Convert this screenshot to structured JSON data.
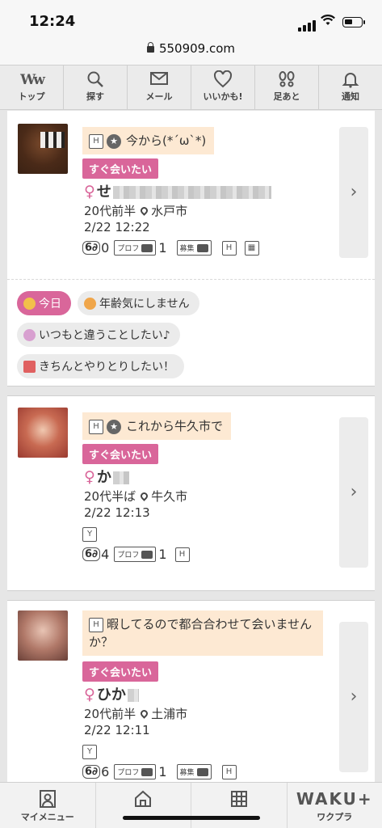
{
  "status": {
    "time": "12:24"
  },
  "browser": {
    "url": "550909.com"
  },
  "topnav": [
    {
      "label": "トップ",
      "icon": "ww-logo-icon",
      "glyph": "Ww"
    },
    {
      "label": "探す",
      "icon": "search-icon",
      "glyph": "⌕"
    },
    {
      "label": "メール",
      "icon": "mail-icon",
      "glyph": "✉"
    },
    {
      "label": "いいかも!",
      "icon": "heart-icon",
      "glyph": "♡"
    },
    {
      "label": "足あと",
      "icon": "footprints-icon",
      "glyph": "❀"
    },
    {
      "label": "通知",
      "icon": "bell-icon",
      "glyph": "🔔"
    }
  ],
  "cards": [
    {
      "message": "今から(*´ω`*)",
      "badge": "すぐ会いたい",
      "name": "せ",
      "age": "20代前半",
      "location": "水戸市",
      "datetime": "2/22 12:22",
      "views": "0",
      "prof_label": "プロフ",
      "prof_photos": "1",
      "boshu_label": "募集"
    },
    {
      "message": "これから牛久市で",
      "badge": "すぐ会いたい",
      "name": "か",
      "age": "20代半ば",
      "location": "牛久市",
      "datetime": "2/22 12:13",
      "views": "4",
      "prof_label": "プロフ",
      "prof_photos": "1"
    },
    {
      "message": "暇してるので都合合わせて会いませんか？",
      "badge": "すぐ会いたい",
      "name": "ひか",
      "age": "20代前半",
      "location": "土浦市",
      "datetime": "2/22 12:11",
      "views": "6",
      "prof_label": "プロフ",
      "prof_photos": "1",
      "boshu_label": "募集"
    }
  ],
  "tags": {
    "today": "今日",
    "age": "年齢気にしません",
    "different": "いつもと違うことしたい♪",
    "exchange": "きちんとやりとりしたい！"
  },
  "bottomnav": [
    {
      "label": "マイメニュー",
      "icon": "profile-icon"
    },
    {
      "label": "",
      "icon": "home-icon"
    },
    {
      "label": "",
      "icon": "grid-icon"
    },
    {
      "label": "ワクプラ",
      "icon": "waku-logo",
      "logo": "WAKU+"
    }
  ]
}
